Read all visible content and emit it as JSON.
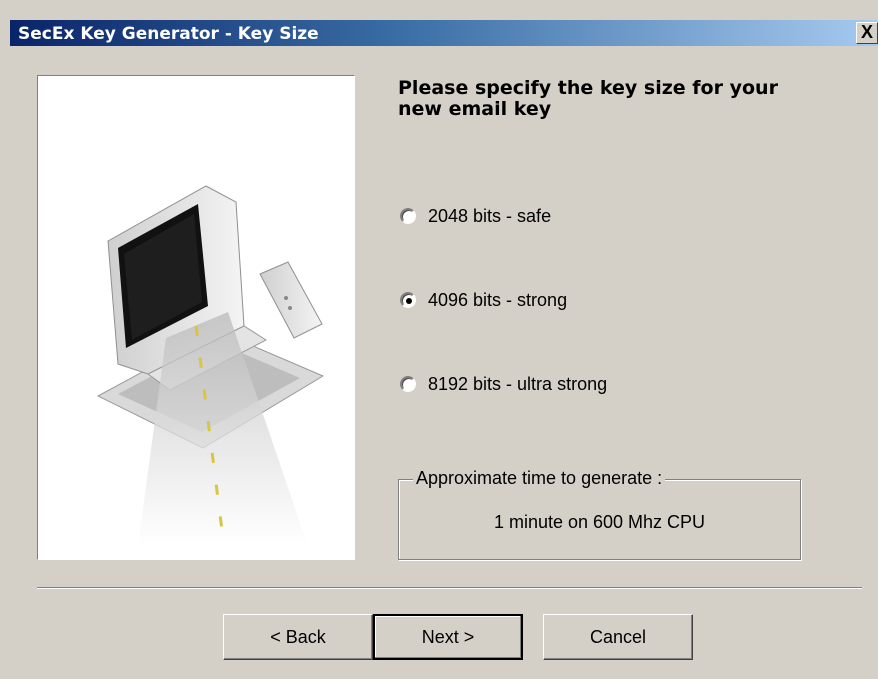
{
  "window": {
    "title": "SecEx Key Generator - Key Size",
    "close_label": "X"
  },
  "illustration": {
    "icon": "computer-illustration"
  },
  "heading": "Please specify the key size for your new email key",
  "options": [
    {
      "label": "2048 bits -  safe",
      "selected": false
    },
    {
      "label": "4096 bits -  strong",
      "selected": true
    },
    {
      "label": "8192 bits  -  ultra strong",
      "selected": false
    }
  ],
  "estimate": {
    "legend": "Approximate time to generate :",
    "value": "1 minute on 600 Mhz  CPU"
  },
  "buttons": {
    "back": "< Back",
    "next": "Next >",
    "cancel": "Cancel"
  }
}
